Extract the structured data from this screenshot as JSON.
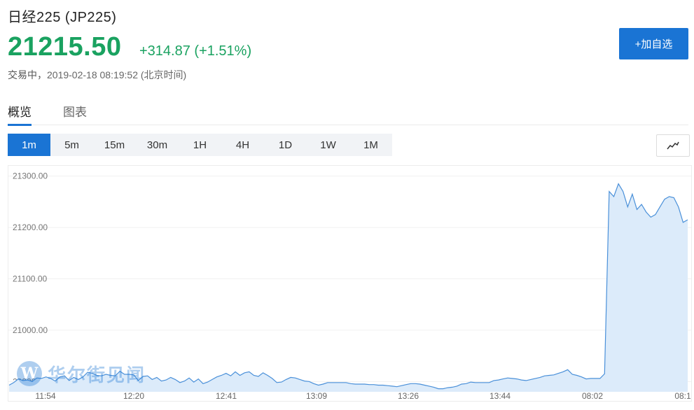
{
  "header": {
    "title": "日经225 (JP225)",
    "price": "21215.50",
    "change": "+314.87 (+1.51%)",
    "status_label": "交易中，",
    "timestamp": "2019-02-18 08:19:52 (北京时间)",
    "add_button": "+加自选",
    "accent_color": "#1a74d4",
    "up_color": "#1aa260"
  },
  "tabs": [
    {
      "label": "概览",
      "active": true
    },
    {
      "label": "图表",
      "active": false
    }
  ],
  "intervals": [
    {
      "label": "1m",
      "active": true
    },
    {
      "label": "5m"
    },
    {
      "label": "15m"
    },
    {
      "label": "30m"
    },
    {
      "label": "1H"
    },
    {
      "label": "4H"
    },
    {
      "label": "1D"
    },
    {
      "label": "1W"
    },
    {
      "label": "1M"
    }
  ],
  "chart_type_icon": "line-chart-icon",
  "watermark": {
    "logo": "W",
    "text": "华尔街见闻"
  },
  "chart_data": {
    "type": "area",
    "ylim": [
      20880,
      21320
    ],
    "y_ticks": [
      "21300.00",
      "21200.00",
      "21100.00",
      "21000.00",
      "20900.00"
    ],
    "y_tick_values": [
      21300,
      21200,
      21100,
      21000,
      20900
    ],
    "x_ticks": [
      "11:54",
      "12:20",
      "12:41",
      "13:09",
      "13:26",
      "13:44",
      "08:02",
      "08:1"
    ],
    "series": [
      {
        "values": [
          20893,
          20898,
          20905,
          20902,
          20903,
          20900,
          20907,
          20906,
          20909,
          20906,
          20901,
          20909,
          20911,
          20902,
          20908,
          20904,
          20909,
          20918,
          20916,
          20912,
          20911,
          20914,
          20912,
          20911,
          20920,
          20914,
          20914,
          20913,
          20902,
          20910,
          20911,
          20904,
          20908,
          20901,
          20903,
          20908,
          20904,
          20898,
          20901,
          20907,
          20899,
          20905,
          20896,
          20899,
          20904,
          20909,
          20912,
          20916,
          20911,
          20919,
          20912,
          20917,
          20919,
          20912,
          20910,
          20917,
          20912,
          20906,
          20898,
          20899,
          20904,
          20908,
          20907,
          20904,
          20901,
          20900,
          20896,
          20893,
          20895,
          20898,
          20898,
          20898,
          20898,
          20898,
          20896,
          20895,
          20895,
          20895,
          20894,
          20894,
          20893,
          20893,
          20892,
          20891,
          20890,
          20892,
          20894,
          20896,
          20896,
          20895,
          20893,
          20891,
          20889,
          20886,
          20886,
          20888,
          20889,
          20891,
          20895,
          20896,
          20899,
          20898,
          20898,
          20898,
          20898,
          20902,
          20903,
          20905,
          20907,
          20906,
          20905,
          20903,
          20902,
          20904,
          20906,
          20908,
          20911,
          20912,
          20913,
          20916,
          20919,
          20923,
          20914,
          20912,
          20909,
          20905,
          20906,
          20906,
          20906,
          20915,
          21270,
          21260,
          21285,
          21270,
          21240,
          21265,
          21235,
          21245,
          21230,
          21220,
          21225,
          21240,
          21255,
          21260,
          21258,
          21240,
          21210,
          21215
        ]
      }
    ]
  }
}
